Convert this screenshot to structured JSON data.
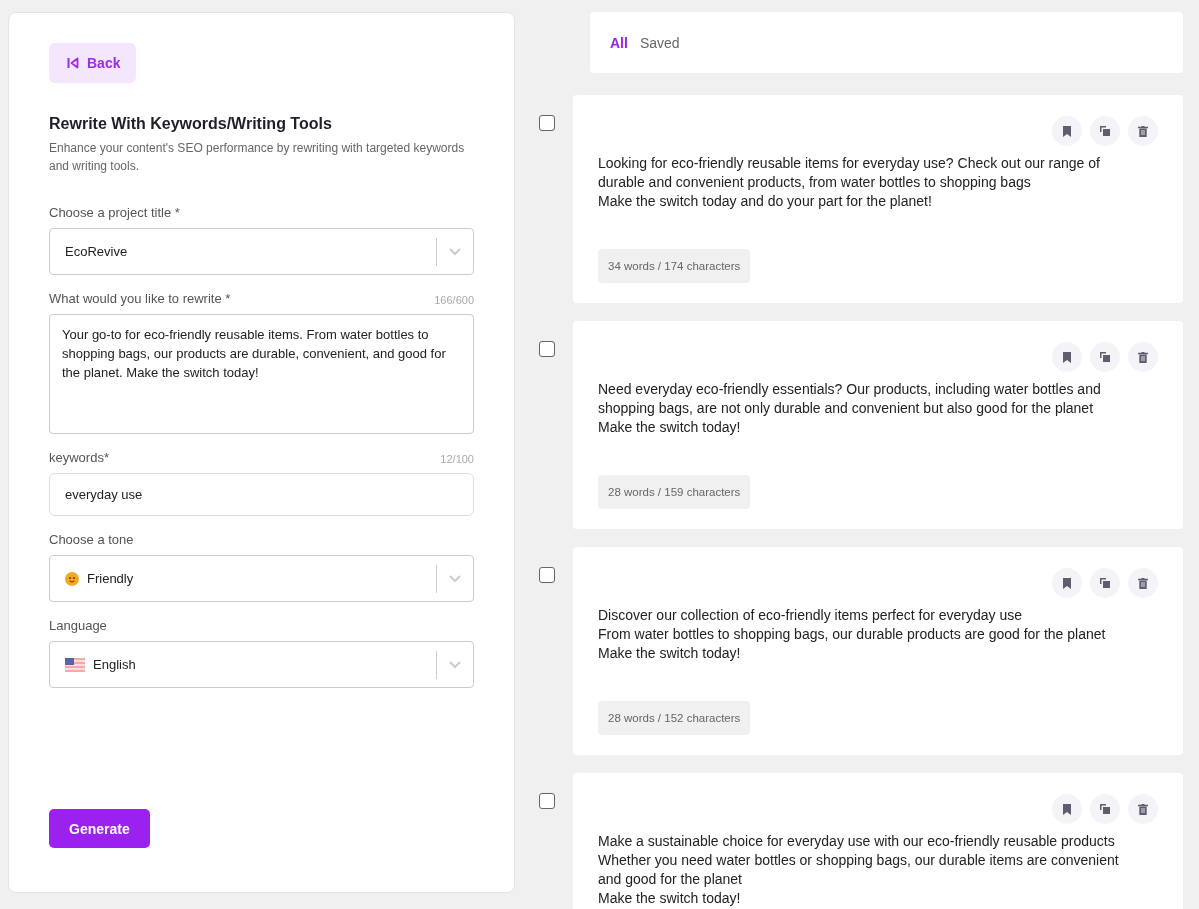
{
  "back_button": {
    "label": "Back"
  },
  "form": {
    "title": "Rewrite With Keywords/Writing Tools",
    "description": "Enhance your content's SEO performance by rewriting with targeted keywords and writing tools.",
    "fields": [
      {
        "kind": "select",
        "label": "Choose a project title *",
        "value": "EcoRevive"
      },
      {
        "kind": "textarea",
        "label": "What would you like to rewrite *",
        "counter": "166/600",
        "value": "Your go-to for eco-friendly reusable items. From water bottles to shopping bags, our products are durable, convenient, and good for the planet. Make the switch today!"
      },
      {
        "kind": "input",
        "label": "keywords*",
        "counter": "12/100",
        "value": "everyday use"
      },
      {
        "kind": "emojiselect",
        "label": "Choose a tone",
        "value": "Friendly"
      },
      {
        "kind": "flagselect",
        "label": "Language",
        "value": "English"
      }
    ],
    "generate_button": "Generate"
  },
  "tabs": [
    {
      "label": "All",
      "selected": true
    },
    {
      "label": "Saved",
      "selected": false
    }
  ],
  "results": [
    {
      "checked": false,
      "text": "Looking for eco-friendly reusable items for everyday use? Check out our range of durable and convenient products, from water bottles to shopping bags\nMake the switch today and do your part for the planet!",
      "stats": "34 words / 174 characters"
    },
    {
      "checked": false,
      "text": "Need everyday eco-friendly essentials? Our products, including water bottles and shopping bags, are not only durable and convenient but also good for the planet\nMake the switch today!",
      "stats": "28 words / 159 characters"
    },
    {
      "checked": false,
      "text": "Discover our collection of eco-friendly items perfect for everyday use\nFrom water bottles to shopping bags, our durable products are good for the planet\nMake the switch today!",
      "stats": "28 words / 152 characters"
    },
    {
      "checked": false,
      "text": "Make a sustainable choice for everyday use with our eco-friendly reusable products\nWhether you need water bottles or shopping bags, our durable items are convenient and good for the planet\nMake the switch today!"
    }
  ]
}
